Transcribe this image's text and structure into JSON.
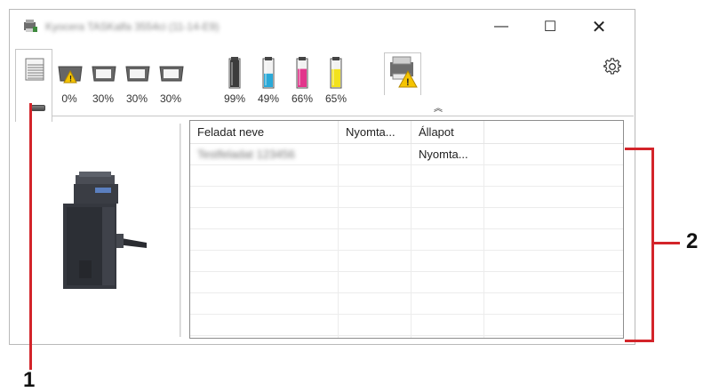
{
  "window": {
    "title": "Kyocera TASKalfa 3554ci (11-14-E9)",
    "controls": {
      "minimize": "—",
      "maximize": "☐",
      "close": "✕"
    }
  },
  "toolbar": {
    "trays": [
      {
        "label": "0%",
        "alert": true
      },
      {
        "label": "30%",
        "alert": false
      },
      {
        "label": "30%",
        "alert": false
      },
      {
        "label": "30%",
        "alert": false
      }
    ],
    "toners": [
      {
        "label": "99%",
        "color": "#3c3c3c",
        "level": 0.99
      },
      {
        "label": "49%",
        "color": "#2aa9d8",
        "level": 0.49
      },
      {
        "label": "66%",
        "color": "#e2368c",
        "level": 0.66
      },
      {
        "label": "65%",
        "color": "#f2e21d",
        "level": 0.65
      }
    ],
    "collapse_icon": "chevron-up-icon",
    "settings_icon": "gear-icon"
  },
  "job_list": {
    "columns": [
      "Feladat neve",
      "Nyomta...",
      "Állapot"
    ],
    "rows": [
      {
        "name": "Testfeladat 123456",
        "printed": "",
        "status": "Nyomta..."
      }
    ]
  },
  "callouts": {
    "one": "1",
    "two": "2"
  },
  "colors": {
    "callout_line": "#d3242a"
  }
}
